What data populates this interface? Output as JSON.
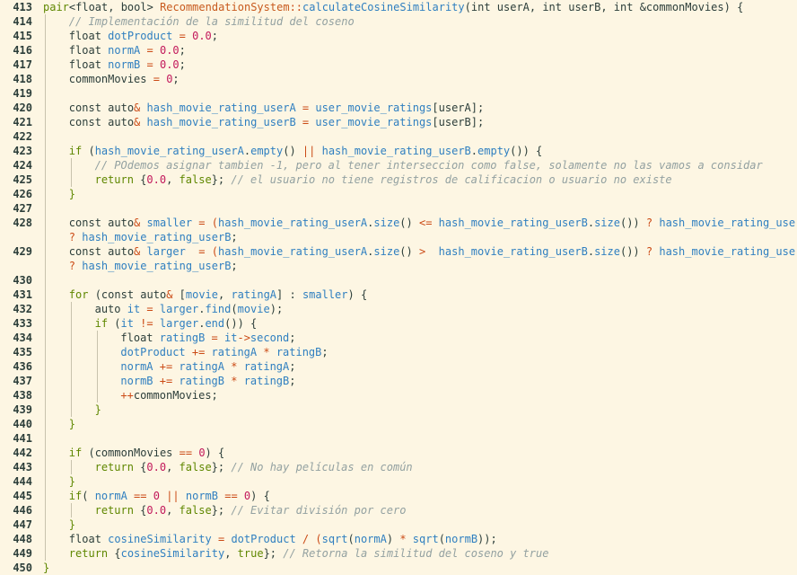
{
  "editor": {
    "theme_colors": {
      "background": "#fdf6e3",
      "keyword": "#5f8700",
      "function": "#2f7fc0",
      "class": "#c85a1e",
      "number": "#c2185b",
      "comment": "#93a1a1"
    },
    "lines": [
      {
        "n": "413",
        "lvl": 0,
        "tokens": [
          [
            "pair",
            "kw"
          ],
          [
            "<float, bool> ",
            "pl"
          ],
          [
            "RecommendationSystem",
            "cls"
          ],
          [
            "::",
            "op"
          ],
          [
            "calculateCosineSimilarity",
            "fn"
          ],
          [
            "(int userA, int userB, int &commonMovies) {",
            "pl"
          ]
        ]
      },
      {
        "n": "414",
        "lvl": 1,
        "tokens": [
          [
            "// Implementación de la similitud del coseno",
            "com"
          ]
        ]
      },
      {
        "n": "415",
        "lvl": 1,
        "tokens": [
          [
            "float ",
            "pl"
          ],
          [
            "dotProduct",
            "var"
          ],
          [
            " = ",
            "op"
          ],
          [
            "0.0",
            "num"
          ],
          [
            ";",
            "pl"
          ]
        ]
      },
      {
        "n": "416",
        "lvl": 1,
        "tokens": [
          [
            "float ",
            "pl"
          ],
          [
            "normA",
            "var"
          ],
          [
            " = ",
            "op"
          ],
          [
            "0.0",
            "num"
          ],
          [
            ";",
            "pl"
          ]
        ]
      },
      {
        "n": "417",
        "lvl": 1,
        "tokens": [
          [
            "float ",
            "pl"
          ],
          [
            "normB",
            "var"
          ],
          [
            " = ",
            "op"
          ],
          [
            "0.0",
            "num"
          ],
          [
            ";",
            "pl"
          ]
        ]
      },
      {
        "n": "418",
        "lvl": 1,
        "tokens": [
          [
            "commonMovies",
            "pl"
          ],
          [
            " = ",
            "op"
          ],
          [
            "0",
            "num"
          ],
          [
            ";",
            "pl"
          ]
        ]
      },
      {
        "n": "419",
        "lvl": 1,
        "tokens": []
      },
      {
        "n": "420",
        "lvl": 1,
        "tokens": [
          [
            "const auto",
            "pl"
          ],
          [
            "& ",
            "op"
          ],
          [
            "hash_movie_rating_userA",
            "var"
          ],
          [
            " = ",
            "op"
          ],
          [
            "user_movie_ratings",
            "var"
          ],
          [
            "[userA];",
            "pl"
          ]
        ]
      },
      {
        "n": "421",
        "lvl": 1,
        "tokens": [
          [
            "const auto",
            "pl"
          ],
          [
            "& ",
            "op"
          ],
          [
            "hash_movie_rating_userB",
            "var"
          ],
          [
            " = ",
            "op"
          ],
          [
            "user_movie_ratings",
            "var"
          ],
          [
            "[userB];",
            "pl"
          ]
        ]
      },
      {
        "n": "422",
        "lvl": 1,
        "tokens": []
      },
      {
        "n": "423",
        "lvl": 1,
        "tokens": [
          [
            "if",
            "kw"
          ],
          [
            " (",
            "pl"
          ],
          [
            "hash_movie_rating_userA",
            "var"
          ],
          [
            ".",
            "pl"
          ],
          [
            "empty",
            "fn"
          ],
          [
            "() ",
            "pl"
          ],
          [
            "||",
            "op"
          ],
          [
            " ",
            "pl"
          ],
          [
            "hash_movie_rating_userB",
            "var"
          ],
          [
            ".",
            "pl"
          ],
          [
            "empty",
            "fn"
          ],
          [
            "()) {",
            "pl"
          ]
        ]
      },
      {
        "n": "424",
        "lvl": 2,
        "tokens": [
          [
            "// POdemos asignar tambien -1, pero al tener interseccion como false, solamente no las vamos a considar",
            "com"
          ]
        ]
      },
      {
        "n": "425",
        "lvl": 2,
        "tokens": [
          [
            "return",
            "kw"
          ],
          [
            " {",
            "pl"
          ],
          [
            "0.0",
            "num"
          ],
          [
            ", ",
            "pl"
          ],
          [
            "false",
            "kw"
          ],
          [
            "}; ",
            "pl"
          ],
          [
            "// el usuario no tiene registros de calificacion o usuario no existe",
            "com"
          ]
        ]
      },
      {
        "n": "426",
        "lvl": 1,
        "tokens": [
          [
            "}",
            "kw"
          ]
        ]
      },
      {
        "n": "427",
        "lvl": 1,
        "tokens": []
      },
      {
        "n": "428",
        "lvl": 1,
        "tokens": [
          [
            "const auto",
            "pl"
          ],
          [
            "& ",
            "op"
          ],
          [
            "smaller",
            "var"
          ],
          [
            " = (",
            "op"
          ],
          [
            "hash_movie_rating_userA",
            "var"
          ],
          [
            ".",
            "pl"
          ],
          [
            "size",
            "fn"
          ],
          [
            "() ",
            "pl"
          ],
          [
            "<=",
            "op"
          ],
          [
            " ",
            "pl"
          ],
          [
            "hash_movie_rating_userB",
            "var"
          ],
          [
            ".",
            "pl"
          ],
          [
            "size",
            "fn"
          ],
          [
            "()) ",
            "pl"
          ],
          [
            "?",
            "op"
          ],
          [
            " ",
            "pl"
          ],
          [
            "hash_movie_rating_userA",
            "var"
          ]
        ]
      },
      {
        "n": "",
        "lvl": 1,
        "tokens": [
          [
            "? ",
            "op"
          ],
          [
            "hash_movie_rating_userB",
            "var"
          ],
          [
            ";",
            "pl"
          ]
        ]
      },
      {
        "n": "429",
        "lvl": 1,
        "tokens": [
          [
            "const auto",
            "pl"
          ],
          [
            "& ",
            "op"
          ],
          [
            "larger",
            "var"
          ],
          [
            "  = (",
            "op"
          ],
          [
            "hash_movie_rating_userA",
            "var"
          ],
          [
            ".",
            "pl"
          ],
          [
            "size",
            "fn"
          ],
          [
            "() ",
            "pl"
          ],
          [
            ">",
            "op"
          ],
          [
            "  ",
            "pl"
          ],
          [
            "hash_movie_rating_userB",
            "var"
          ],
          [
            ".",
            "pl"
          ],
          [
            "size",
            "fn"
          ],
          [
            "()) ",
            "pl"
          ],
          [
            "?",
            "op"
          ],
          [
            " ",
            "pl"
          ],
          [
            "hash_movie_rating_userA",
            "var"
          ]
        ]
      },
      {
        "n": "",
        "lvl": 1,
        "tokens": [
          [
            "? ",
            "op"
          ],
          [
            "hash_movie_rating_userB",
            "var"
          ],
          [
            ";",
            "pl"
          ]
        ]
      },
      {
        "n": "430",
        "lvl": 1,
        "tokens": []
      },
      {
        "n": "431",
        "lvl": 1,
        "tokens": [
          [
            "for",
            "kw"
          ],
          [
            " (const auto",
            "pl"
          ],
          [
            "& ",
            "op"
          ],
          [
            "[",
            "pl"
          ],
          [
            "movie",
            "var"
          ],
          [
            ", ",
            "pl"
          ],
          [
            "ratingA",
            "var"
          ],
          [
            "] : ",
            "pl"
          ],
          [
            "smaller",
            "var"
          ],
          [
            ") {",
            "pl"
          ]
        ]
      },
      {
        "n": "432",
        "lvl": 2,
        "tokens": [
          [
            "auto ",
            "pl"
          ],
          [
            "it",
            "var"
          ],
          [
            " = ",
            "op"
          ],
          [
            "larger",
            "var"
          ],
          [
            ".",
            "pl"
          ],
          [
            "find",
            "fn"
          ],
          [
            "(",
            "pl"
          ],
          [
            "movie",
            "var"
          ],
          [
            ");",
            "pl"
          ]
        ]
      },
      {
        "n": "433",
        "lvl": 2,
        "tokens": [
          [
            "if",
            "kw"
          ],
          [
            " (",
            "pl"
          ],
          [
            "it",
            "var"
          ],
          [
            " != ",
            "op"
          ],
          [
            "larger",
            "var"
          ],
          [
            ".",
            "pl"
          ],
          [
            "end",
            "fn"
          ],
          [
            "()) {",
            "pl"
          ]
        ]
      },
      {
        "n": "434",
        "lvl": 3,
        "tokens": [
          [
            "float ",
            "pl"
          ],
          [
            "ratingB",
            "var"
          ],
          [
            " = ",
            "op"
          ],
          [
            "it",
            "var"
          ],
          [
            "->",
            "op"
          ],
          [
            "second",
            "var"
          ],
          [
            ";",
            "pl"
          ]
        ]
      },
      {
        "n": "435",
        "lvl": 3,
        "tokens": [
          [
            "dotProduct",
            "var"
          ],
          [
            " += ",
            "op"
          ],
          [
            "ratingA",
            "var"
          ],
          [
            " * ",
            "op"
          ],
          [
            "ratingB",
            "var"
          ],
          [
            ";",
            "pl"
          ]
        ]
      },
      {
        "n": "436",
        "lvl": 3,
        "tokens": [
          [
            "normA",
            "var"
          ],
          [
            " += ",
            "op"
          ],
          [
            "ratingA",
            "var"
          ],
          [
            " * ",
            "op"
          ],
          [
            "ratingA",
            "var"
          ],
          [
            ";",
            "pl"
          ]
        ]
      },
      {
        "n": "437",
        "lvl": 3,
        "tokens": [
          [
            "normB",
            "var"
          ],
          [
            " += ",
            "op"
          ],
          [
            "ratingB",
            "var"
          ],
          [
            " * ",
            "op"
          ],
          [
            "ratingB",
            "var"
          ],
          [
            ";",
            "pl"
          ]
        ]
      },
      {
        "n": "438",
        "lvl": 3,
        "tokens": [
          [
            "++",
            "op"
          ],
          [
            "commonMovies;",
            "pl"
          ]
        ]
      },
      {
        "n": "439",
        "lvl": 2,
        "tokens": [
          [
            "}",
            "kw"
          ]
        ]
      },
      {
        "n": "440",
        "lvl": 1,
        "tokens": [
          [
            "}",
            "kw"
          ]
        ]
      },
      {
        "n": "441",
        "lvl": 1,
        "tokens": []
      },
      {
        "n": "442",
        "lvl": 1,
        "tokens": [
          [
            "if",
            "kw"
          ],
          [
            " (commonMovies ",
            "pl"
          ],
          [
            "==",
            "op"
          ],
          [
            " ",
            "pl"
          ],
          [
            "0",
            "num"
          ],
          [
            ") {",
            "pl"
          ]
        ]
      },
      {
        "n": "443",
        "lvl": 2,
        "tokens": [
          [
            "return",
            "kw"
          ],
          [
            " {",
            "pl"
          ],
          [
            "0.0",
            "num"
          ],
          [
            ", ",
            "pl"
          ],
          [
            "false",
            "kw"
          ],
          [
            "}; ",
            "pl"
          ],
          [
            "// No hay películas en común",
            "com"
          ]
        ]
      },
      {
        "n": "444",
        "lvl": 1,
        "tokens": [
          [
            "}",
            "kw"
          ]
        ]
      },
      {
        "n": "445",
        "lvl": 1,
        "tokens": [
          [
            "if",
            "kw"
          ],
          [
            "( ",
            "pl"
          ],
          [
            "normA",
            "var"
          ],
          [
            " == ",
            "op"
          ],
          [
            "0",
            "num"
          ],
          [
            " || ",
            "op"
          ],
          [
            "normB",
            "var"
          ],
          [
            " == ",
            "op"
          ],
          [
            "0",
            "num"
          ],
          [
            ") {",
            "pl"
          ]
        ]
      },
      {
        "n": "446",
        "lvl": 2,
        "tokens": [
          [
            "return",
            "kw"
          ],
          [
            " {",
            "pl"
          ],
          [
            "0.0",
            "num"
          ],
          [
            ", ",
            "pl"
          ],
          [
            "false",
            "kw"
          ],
          [
            "}; ",
            "pl"
          ],
          [
            "// Evitar división por cero",
            "com"
          ]
        ]
      },
      {
        "n": "447",
        "lvl": 1,
        "tokens": [
          [
            "}",
            "kw"
          ]
        ]
      },
      {
        "n": "448",
        "lvl": 1,
        "tokens": [
          [
            "float ",
            "pl"
          ],
          [
            "cosineSimilarity",
            "var"
          ],
          [
            " = ",
            "op"
          ],
          [
            "dotProduct",
            "var"
          ],
          [
            " / (",
            "op"
          ],
          [
            "sqrt",
            "fn"
          ],
          [
            "(",
            "pl"
          ],
          [
            "normA",
            "var"
          ],
          [
            ") ",
            "pl"
          ],
          [
            "*",
            "op"
          ],
          [
            " ",
            "pl"
          ],
          [
            "sqrt",
            "fn"
          ],
          [
            "(",
            "pl"
          ],
          [
            "normB",
            "var"
          ],
          [
            "));",
            "pl"
          ]
        ]
      },
      {
        "n": "449",
        "lvl": 1,
        "tokens": [
          [
            "return",
            "kw"
          ],
          [
            " {",
            "pl"
          ],
          [
            "cosineSimilarity",
            "var"
          ],
          [
            ", ",
            "pl"
          ],
          [
            "true",
            "kw"
          ],
          [
            "}; ",
            "pl"
          ],
          [
            "// Retorna la similitud del coseno y true",
            "com"
          ]
        ]
      },
      {
        "n": "450",
        "lvl": 0,
        "tokens": [
          [
            "}",
            "kw"
          ]
        ]
      }
    ]
  }
}
